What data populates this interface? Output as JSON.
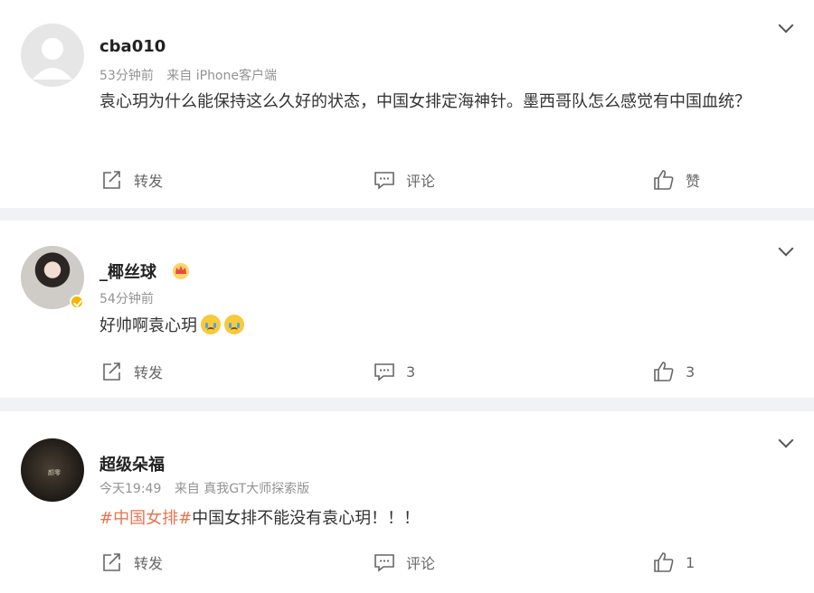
{
  "posts": [
    {
      "username": "cba010",
      "time": "53分钟前",
      "source": "来自 iPhone客户端",
      "content_parts": [
        "袁心玥为什么能保持这么久好的状态，中国女排定海神针。墨西哥队怎么感觉有中国血统？"
      ],
      "actions": {
        "forward": "转发",
        "comment": "评论",
        "like": "赞"
      },
      "avatar_icon": "default-avatar-icon"
    },
    {
      "username": "_椰丝球",
      "time": "54分钟前",
      "source": "",
      "content_parts": [
        "好帅啊袁心玥"
      ],
      "actions": {
        "forward": "转发",
        "comment": "3",
        "like": "3"
      },
      "avatar_icon": "portrait-avatar",
      "badge_icon": "crown-icon",
      "verified_icon": "verified-badge-icon"
    },
    {
      "username": "超级朵福",
      "time": "今天19:49",
      "source": "来自 真我GT大师探索版",
      "hashtag": "#中国女排#",
      "content_parts": [
        "中国女排不能没有袁心玥！！！"
      ],
      "actions": {
        "forward": "转发",
        "comment": "评论",
        "like": "1"
      },
      "avatar_icon": "dark-avatar",
      "avatar_text": "颜零"
    }
  ],
  "colors": {
    "hashtag": "#eb7350",
    "meta": "#939393",
    "text": "#333333",
    "separator": "#f1f2f5"
  }
}
